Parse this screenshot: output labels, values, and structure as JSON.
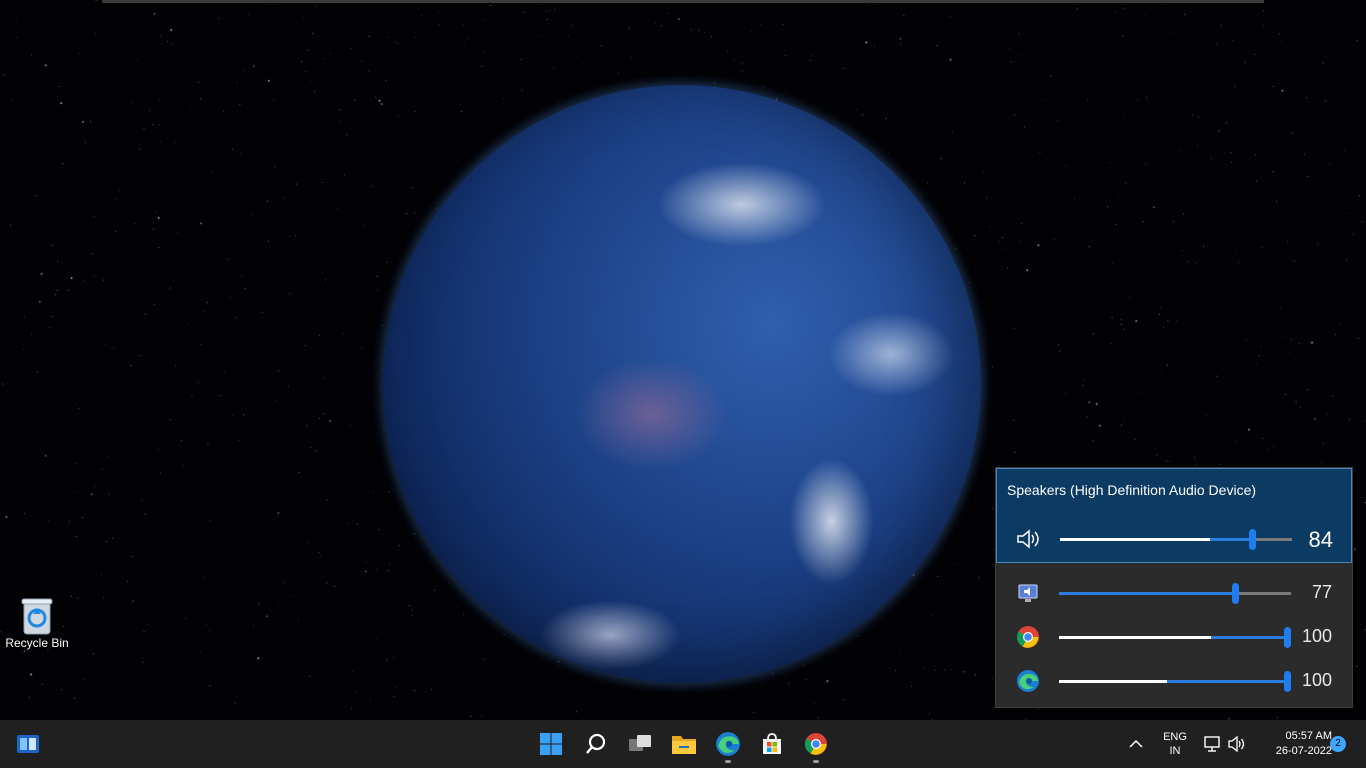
{
  "desktop": {
    "icons": [
      {
        "label": "Recycle Bin",
        "icon": "recycle-bin-icon"
      }
    ]
  },
  "volume_mixer": {
    "device_name": "Speakers (High Definition Audio Device)",
    "master": {
      "icon": "speaker-icon",
      "value": "84",
      "level": 0.84
    },
    "apps": [
      {
        "icon": "system-sounds-icon",
        "value": "77",
        "level": 0.77
      },
      {
        "icon": "chrome-icon",
        "value": "100",
        "level": 1.0
      },
      {
        "icon": "edge-icon",
        "value": "100",
        "level": 1.0
      }
    ],
    "accent_color": "#1e7ef0"
  },
  "taskbar": {
    "left_icon": "widgets-icon",
    "center_icons": [
      "start-icon",
      "search-icon",
      "task-view-icon",
      "file-explorer-icon",
      "edge-icon",
      "store-icon",
      "chrome-icon"
    ],
    "tray": {
      "language_line1": "ENG",
      "language_line2": "IN",
      "time": "05:57 AM",
      "date": "26-07-2022",
      "notification_count": "2"
    }
  }
}
